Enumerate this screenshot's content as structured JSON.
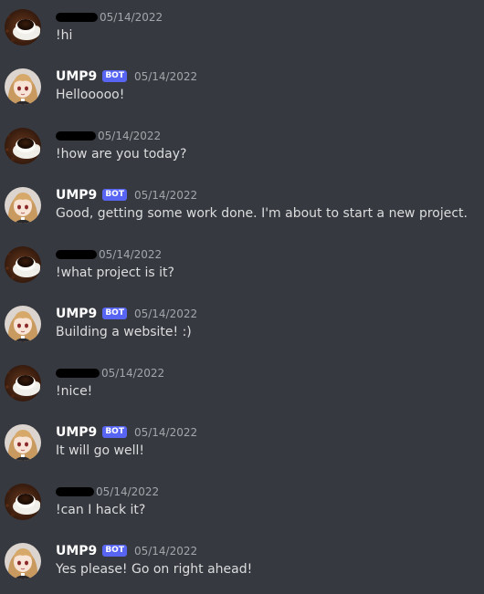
{
  "colors": {
    "background": "#36393f",
    "text": "#dcddde",
    "username": "#ffffff",
    "timestamp": "#a3a6aa",
    "bot_badge": "#5865f2",
    "redaction": "#000000"
  },
  "avatars": {
    "user": "coffee-cup-avatar",
    "bot": "anime-girl-avatar"
  },
  "messages": [
    {
      "author": "",
      "author_redacted": true,
      "timestamp": "05/14/2022",
      "text": "!hi"
    },
    {
      "author": "UMP9",
      "bot_tag": "BOT",
      "timestamp": "05/14/2022",
      "text": "Hellooooo!"
    },
    {
      "author": "",
      "author_redacted": true,
      "timestamp": "05/14/2022",
      "text": "!how are you today?"
    },
    {
      "author": "UMP9",
      "bot_tag": "BOT",
      "timestamp": "05/14/2022",
      "text": "Good, getting some work done. I'm about to start a new project."
    },
    {
      "author": "",
      "author_redacted": true,
      "timestamp": "05/14/2022",
      "text": "!what project is it?"
    },
    {
      "author": "UMP9",
      "bot_tag": "BOT",
      "timestamp": "05/14/2022",
      "text": "Building a website! :)"
    },
    {
      "author": "",
      "author_redacted": true,
      "timestamp": "05/14/2022",
      "text": "!nice!"
    },
    {
      "author": "UMP9",
      "bot_tag": "BOT",
      "timestamp": "05/14/2022",
      "text": "It will go well!"
    },
    {
      "author": "",
      "author_redacted": true,
      "timestamp": "05/14/2022",
      "text": "!can I hack it?"
    },
    {
      "author": "UMP9",
      "bot_tag": "BOT",
      "timestamp": "05/14/2022",
      "text": "Yes please! Go on right ahead!"
    }
  ]
}
